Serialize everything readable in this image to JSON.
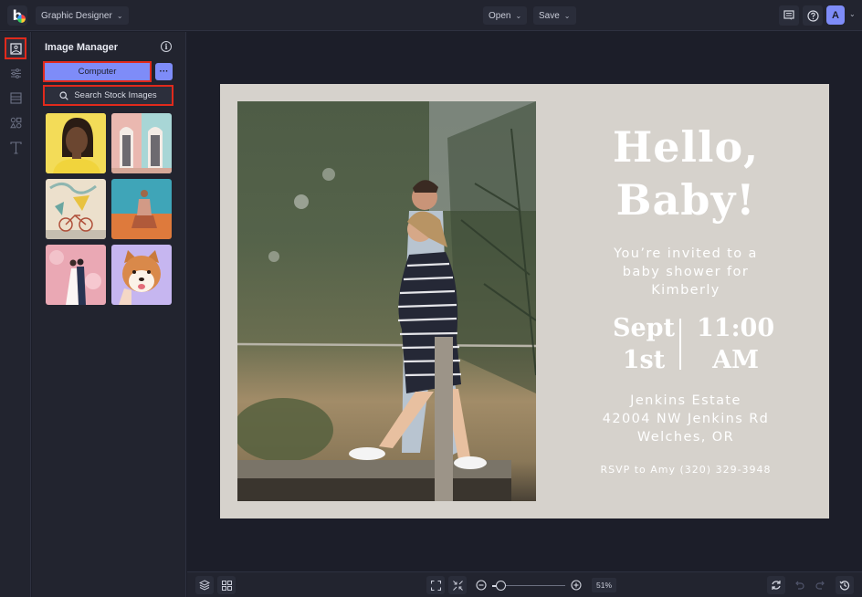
{
  "topbar": {
    "workspace_label": "Graphic Designer",
    "open_label": "Open",
    "save_label": "Save",
    "avatar_initial": "A",
    "icons": [
      "comment-icon",
      "help-icon"
    ]
  },
  "rail": {
    "items": [
      {
        "name": "image-manager",
        "icon": "image-icon",
        "active": true
      },
      {
        "name": "adjustments",
        "icon": "sliders-icon",
        "active": false
      },
      {
        "name": "layout",
        "icon": "layout-icon",
        "active": false
      },
      {
        "name": "graphics",
        "icon": "shapes-icon",
        "active": false
      },
      {
        "name": "text",
        "icon": "text-icon",
        "active": false
      }
    ]
  },
  "panel": {
    "title": "Image Manager",
    "computer_label": "Computer",
    "more_label": "···",
    "search_label": "Search Stock Images",
    "thumbnails": [
      {
        "subject": "woman portrait on yellow"
      },
      {
        "subject": "pastel doors"
      },
      {
        "subject": "bicycle against mural"
      },
      {
        "subject": "man sitting on sand"
      },
      {
        "subject": "wedding couple with pink blossoms"
      },
      {
        "subject": "shiba inu dog"
      }
    ]
  },
  "design": {
    "headline_line1": "Hello,",
    "headline_line2": "Baby!",
    "invite_line1": "You’re invited to a",
    "invite_line2": "baby shower for",
    "invite_line3": "Kimberly",
    "date_line1": "Sept",
    "date_line2": "1st",
    "time_line1": "11:00",
    "time_line2": "AM",
    "venue": "Jenkins Estate",
    "street": "42004 NW Jenkins Rd",
    "city": "Welches, OR",
    "rsvp": "RSVP to Amy (320) 329-3948",
    "background_color": "#d6d2cc",
    "text_color": "#ffffff"
  },
  "bottombar": {
    "zoom_value": "51%",
    "zoom_fraction": 0.05
  },
  "colors": {
    "accent": "#7e8cf8",
    "highlight": "#e02a1c",
    "app_bg": "#1c1e29",
    "panel_bg": "#22242f"
  }
}
